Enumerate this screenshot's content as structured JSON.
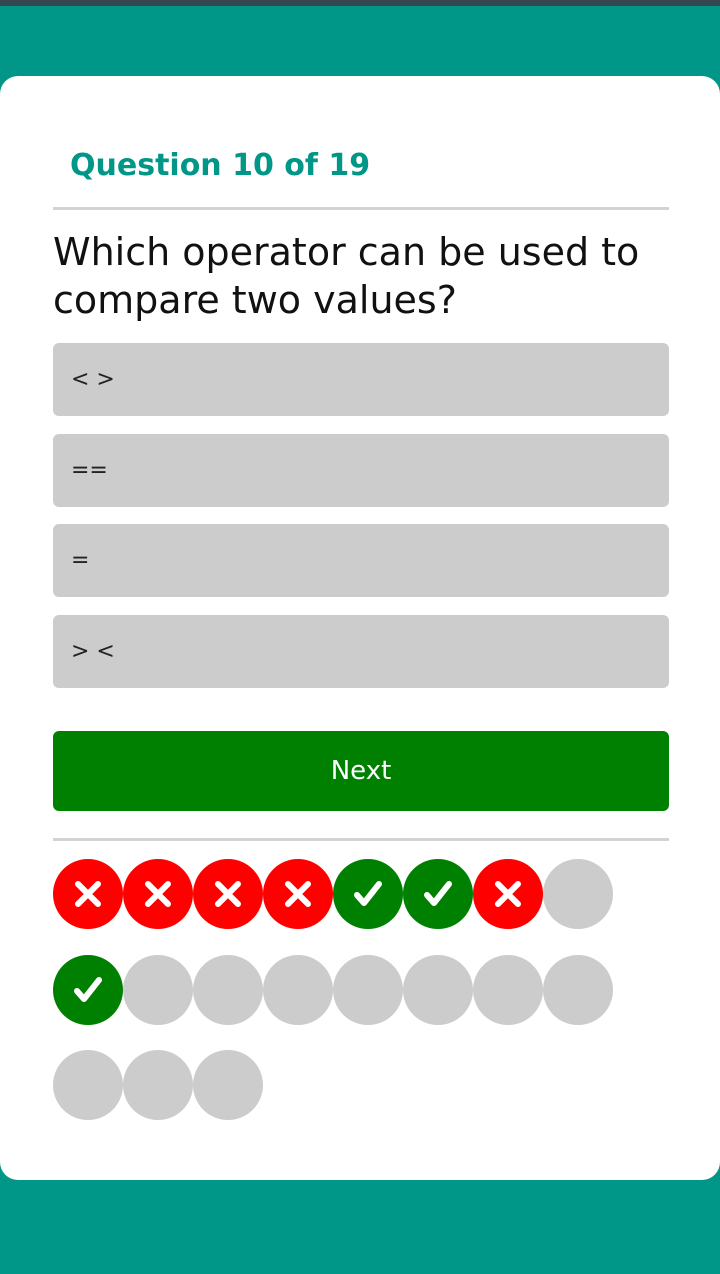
{
  "quiz": {
    "counter": "Question 10 of 19",
    "question": "Which operator can be used to compare two values?",
    "options": [
      {
        "label": "< >"
      },
      {
        "label": "=="
      },
      {
        "label": "="
      },
      {
        "label": "> <"
      }
    ],
    "next_label": "Next"
  },
  "progress": {
    "total": 19,
    "results": [
      "wrong",
      "wrong",
      "wrong",
      "wrong",
      "correct",
      "correct",
      "wrong",
      "pending",
      "correct",
      "pending",
      "pending",
      "pending",
      "pending",
      "pending",
      "pending",
      "pending",
      "pending",
      "pending",
      "pending"
    ],
    "icons": {
      "wrong": "x-icon",
      "correct": "check-icon"
    }
  },
  "colors": {
    "accent": "#009688",
    "correct": "#008000",
    "wrong": "#ff0000",
    "pending": "#cccccc",
    "option_bg": "#cccccc"
  }
}
